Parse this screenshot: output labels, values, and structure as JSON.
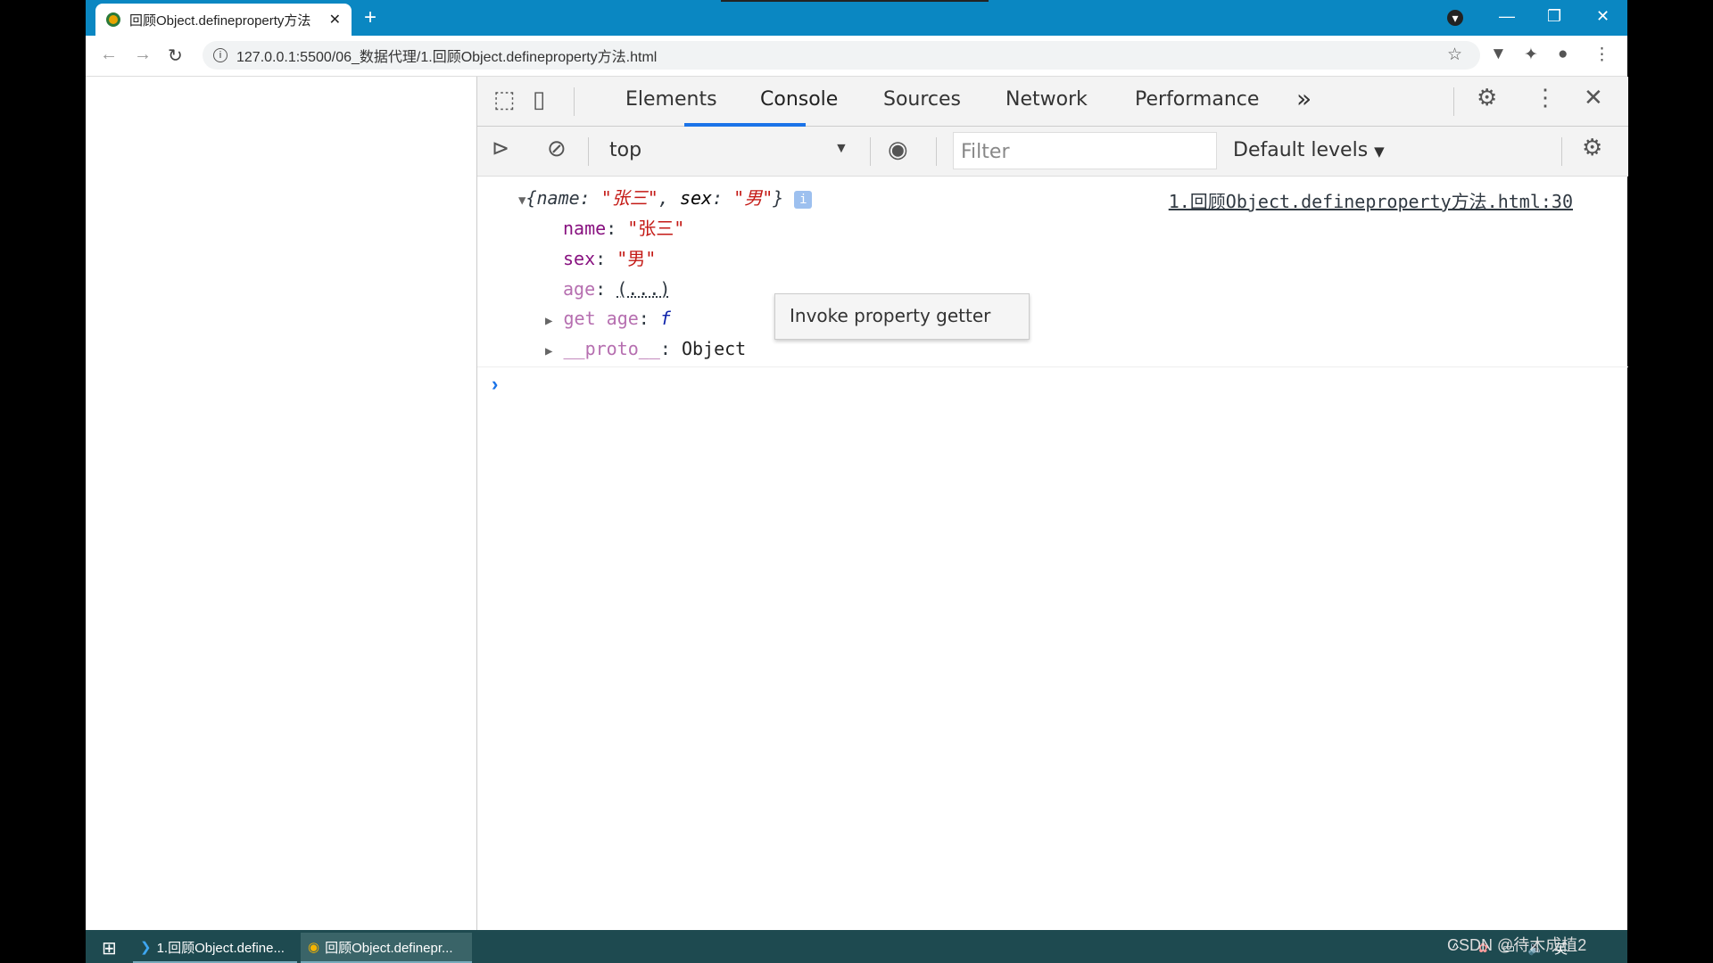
{
  "browser": {
    "tab_title": "回顾Object.defineproperty方法",
    "url": "127.0.0.1:5500/06_数据代理/1.回顾Object.defineproperty方法.html"
  },
  "devtools": {
    "tabs": [
      "Elements",
      "Console",
      "Sources",
      "Network",
      "Performance"
    ],
    "active_tab": "Console",
    "more": "»",
    "context": "top",
    "filter_placeholder": "Filter",
    "levels": "Default levels"
  },
  "console": {
    "summary": {
      "open": "{",
      "name_key": "name",
      "name_val": "\"张三\"",
      "sex_key": "sex",
      "sex_val": "\"男\"",
      "close": "}"
    },
    "props": [
      {
        "key": "name",
        "value": "\"张三\""
      },
      {
        "key": "sex",
        "value": "\"男\""
      },
      {
        "key": "age",
        "value": "(...)"
      },
      {
        "key": "get age",
        "value": "f"
      },
      {
        "key": "__proto__",
        "value": "Object"
      }
    ],
    "source_link": "1.回顾Object.defineproperty方法.html:30",
    "tooltip": "Invoke property getter"
  },
  "taskbar": {
    "items": [
      "1.回顾Object.define...",
      "回顾Object.definepr..."
    ],
    "ime": "英",
    "watermark": "CSDN @待木成植2"
  },
  "colors": {
    "tabbar": "#0a87c2",
    "taskbar": "#1e4a50",
    "accent": "#1a73e8"
  }
}
